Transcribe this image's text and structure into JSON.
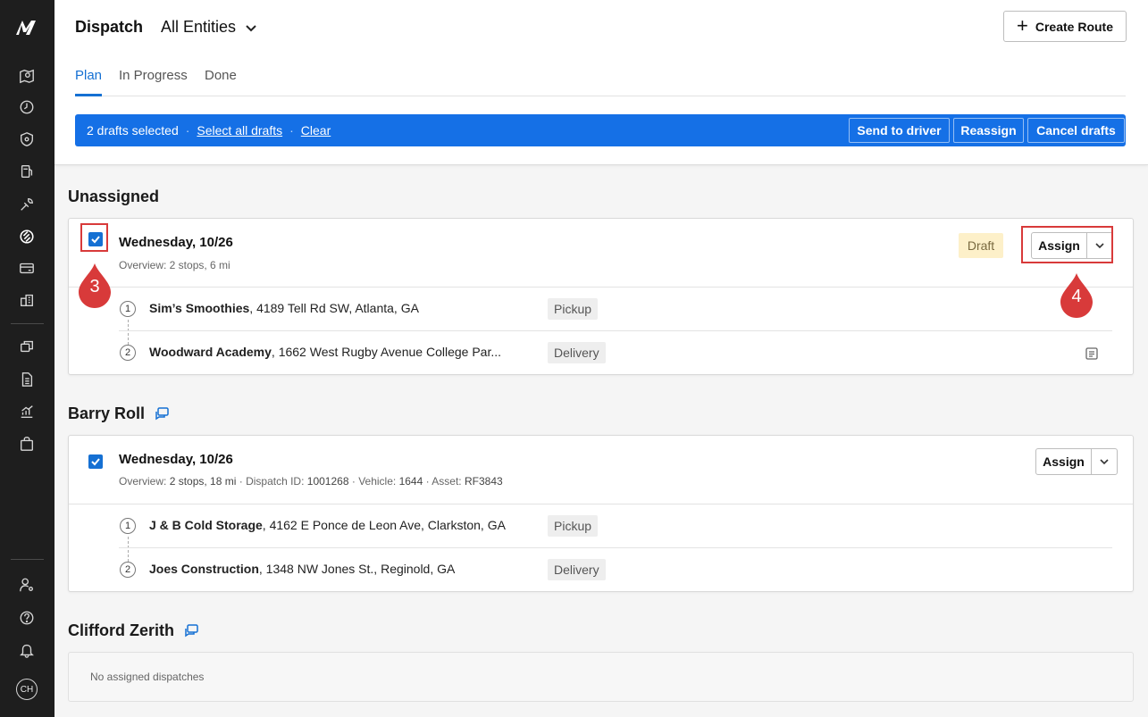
{
  "app": {
    "brand_logo": "M"
  },
  "header": {
    "title": "Dispatch",
    "entity_select": "All Entities",
    "create_button": "Create Route"
  },
  "tabs": [
    {
      "label": "Plan",
      "active": true
    },
    {
      "label": "In Progress",
      "active": false
    },
    {
      "label": "Done",
      "active": false
    }
  ],
  "selection_bar": {
    "count_text": "2 drafts selected",
    "select_all": "Select all drafts",
    "clear": "Clear",
    "separator": "·",
    "buttons": {
      "send": "Send to driver",
      "reassign": "Reassign",
      "cancel": "Cancel drafts"
    }
  },
  "sections": [
    {
      "title": "Unassigned",
      "card": {
        "date": "Wednesday, 10/26",
        "overview": "Overview: 2 stops, 6 mi",
        "badge": "Draft",
        "assign_label": "Assign",
        "checked": true,
        "stops": [
          {
            "num": "1",
            "name": "Sim’s Smoothies",
            "address": ", 4189 Tell Rd SW, Atlanta, GA",
            "type": "Pickup"
          },
          {
            "num": "2",
            "name": "Woodward Academy",
            "address": ", 1662 West Rugby Avenue College Par...",
            "type": "Delivery"
          }
        ]
      }
    },
    {
      "title": "Barry Roll",
      "card": {
        "date": "Wednesday, 10/26",
        "overview_label": "Overview:",
        "overview_value": "2 stops, 18 mi",
        "dispatch_label": "Dispatch ID:",
        "dispatch_value": "1001268",
        "vehicle_label": "Vehicle:",
        "vehicle_value": "1644",
        "asset_label": "Asset:",
        "asset_value": "RF3843",
        "assign_label": "Assign",
        "checked": true,
        "stops": [
          {
            "num": "1",
            "name": "J & B Cold Storage",
            "address": ", 4162 E Ponce de Leon Ave, Clarkston, GA",
            "type": "Pickup"
          },
          {
            "num": "2",
            "name": "Joes Construction",
            "address": ", 1348 NW Jones St., Reginold, GA",
            "type": "Delivery"
          }
        ]
      }
    },
    {
      "title": "Clifford Zerith",
      "empty_text": "No assigned dispatches"
    }
  ],
  "user": {
    "initials": "CH"
  },
  "annotations": {
    "marker_3": "3",
    "marker_4": "4"
  },
  "colors": {
    "accent": "#1570d3",
    "selection_bar": "#1570e6",
    "sidebar": "#1e1e1e",
    "draft_badge_bg": "#fdf0c9",
    "annotation_red": "#d83a3a"
  },
  "icons": {
    "sidebar_top": [
      "map-icon",
      "clock-icon",
      "shield-icon",
      "fuel-icon",
      "wrench-icon",
      "dispatch-route-icon",
      "card-icon",
      "buildings-icon"
    ],
    "sidebar_mid": [
      "copy-icon",
      "document-icon",
      "chart-icon",
      "bag-icon"
    ],
    "sidebar_bottom": [
      "user-settings-icon",
      "help-icon",
      "bell-icon"
    ]
  }
}
